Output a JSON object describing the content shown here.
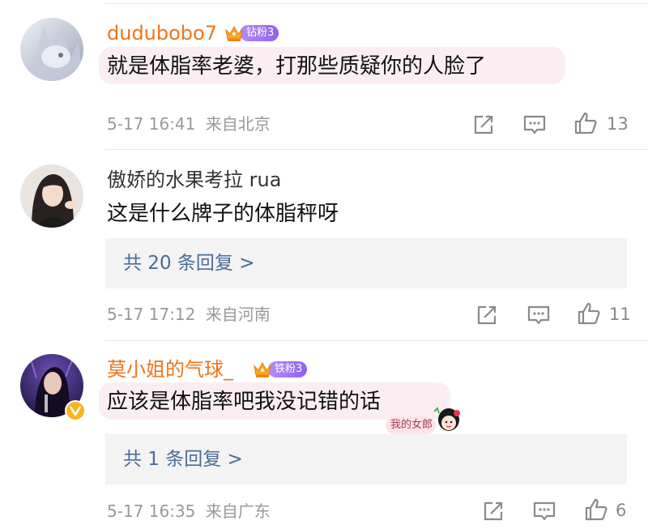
{
  "comments": [
    {
      "username": "dudubobo7",
      "badge": "钻粉3",
      "text": "就是体脂率老婆，打那些质疑你的人脸了",
      "time": "5-17 16:41",
      "location": "来自北京",
      "likes": "13"
    },
    {
      "username": "傲娇的水果考拉 rua",
      "text": "这是什么牌子的体脂秤呀",
      "replies": "共 20 条回复 >",
      "time": "5-17 17:12",
      "location": "来自河南",
      "likes": "11"
    },
    {
      "username": "莫小姐的气球_",
      "badge": "铁粉3",
      "text": "应该是体脂率吧我没记错的话",
      "sticker_text": "我的女郎",
      "replies": "共 1 条回复 >",
      "time": "5-17 16:35",
      "location": "来自广东",
      "likes": "6"
    }
  ],
  "icons": {
    "share": "share-icon",
    "comment": "comment-icon",
    "like": "thumbs-up-icon",
    "verified": "verified-badge-icon",
    "crown": "crown-icon"
  },
  "colors": {
    "username_vip": "#f0741a",
    "reply_link": "#4a6d98",
    "meta": "#999999",
    "bubble": "#fbeef2",
    "badge": "#9a72f2"
  }
}
